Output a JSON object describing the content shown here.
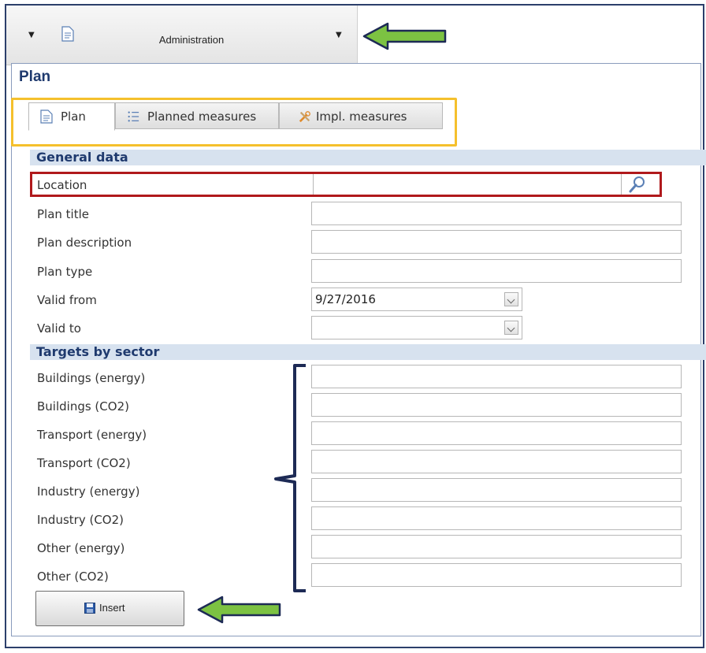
{
  "toolbar": {
    "title": "Administration"
  },
  "panel": {
    "title": "Plan"
  },
  "tabs": [
    {
      "label": "Plan",
      "icon": "document-icon",
      "active": true
    },
    {
      "label": "Planned measures",
      "icon": "list-icon",
      "active": false
    },
    {
      "label": "Impl. measures",
      "icon": "tools-icon",
      "active": false
    }
  ],
  "general_data": {
    "heading": "General data",
    "location_label": "Location",
    "plan_title_label": "Plan title",
    "plan_description_label": "Plan description",
    "plan_type_label": "Plan type",
    "valid_from_label": "Valid from",
    "valid_from_value": "9/27/2016",
    "valid_to_label": "Valid to",
    "valid_to_value": ""
  },
  "targets": {
    "heading": "Targets by sector",
    "rows": [
      {
        "label": "Buildings (energy)",
        "value": ""
      },
      {
        "label": "Buildings (CO2)",
        "value": ""
      },
      {
        "label": "Transport (energy)",
        "value": ""
      },
      {
        "label": "Transport (CO2)",
        "value": ""
      },
      {
        "label": "Industry (energy)",
        "value": ""
      },
      {
        "label": "Industry (CO2)",
        "value": ""
      },
      {
        "label": "Other (energy)",
        "value": ""
      },
      {
        "label": "Other (CO2)",
        "value": ""
      }
    ]
  },
  "actions": {
    "insert_label": "Insert"
  },
  "colors": {
    "accent_arrow": "#7cc242",
    "highlight_tabs": "#f5c02c",
    "highlight_location": "#b0191c",
    "bracket": "#1d2a55",
    "section_bg": "#d7e2ef",
    "heading_text": "#1f3a6e"
  }
}
